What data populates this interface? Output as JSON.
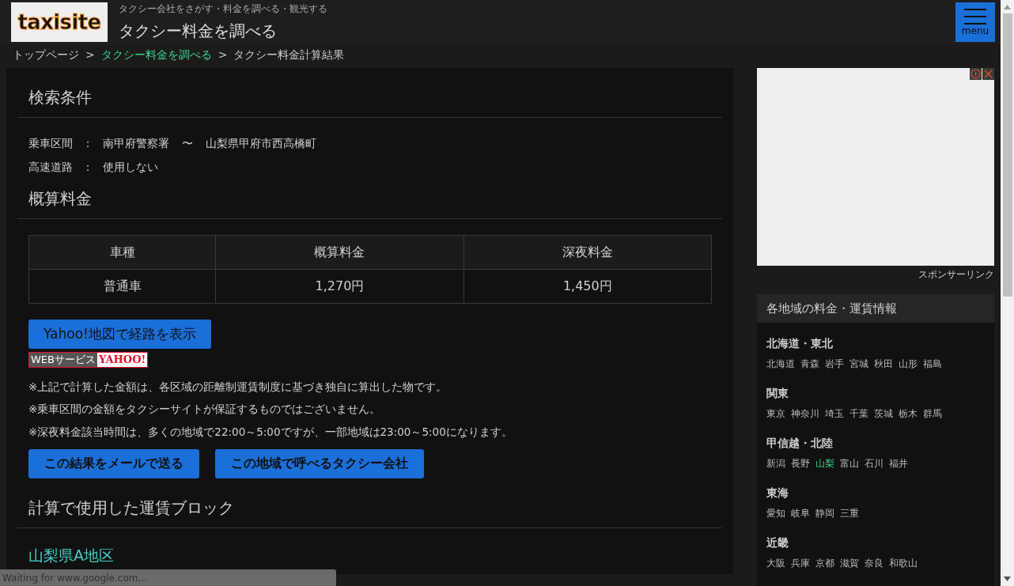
{
  "header": {
    "logo": "taxisite",
    "tagline": "タクシー会社をさがす・料金を調べる・観光する",
    "title": "タクシー料金を調べる",
    "menu_label": "menu"
  },
  "breadcrumb": [
    {
      "label": "トップページ",
      "link": false
    },
    {
      "label": "タクシー料金を調べる",
      "link": true
    },
    {
      "label": "タクシー料金計算結果",
      "link": false
    }
  ],
  "breadcrumb_separator": ">",
  "conditions": {
    "heading": "検索条件",
    "separator": "：",
    "rows": [
      {
        "label": "乗車区間",
        "value_from": "南甲府警察署",
        "connector": "〜",
        "value_to": "山梨県甲府市西高橋町"
      },
      {
        "label": "高速道路",
        "value_from": "使用しない"
      }
    ]
  },
  "fare": {
    "heading": "概算料金",
    "columns": [
      "車種",
      "概算料金",
      "深夜料金"
    ],
    "rows": [
      [
        "普通車",
        "1,270円",
        "1,450円"
      ]
    ]
  },
  "map_button": "Yahoo!地図で経路を表示",
  "yahoo_badge": {
    "left": "WEBサービス",
    "right": "YAHOO!"
  },
  "notes": [
    "※上記で計算した金額は、各区域の距離制運賃制度に基づき独自に算出した物です。",
    "※乗車区間の金額をタクシーサイトが保証するものではございません。",
    "※深夜料金該当時間は、多くの地域で22:00～5:00ですが、一部地域は23:00～5:00になります。"
  ],
  "actions": [
    "この結果をメールで送る",
    "この地域で呼べるタクシー会社"
  ],
  "block": {
    "heading": "計算で使用した運賃ブロック",
    "subheading": "山梨県A地区"
  },
  "ad": {
    "caption": "スポンサーリンク"
  },
  "regions": {
    "heading": "各地域の料金・運賃情報",
    "groups": [
      {
        "name": "北海道・東北",
        "items": [
          {
            "label": "北海道",
            "selected": false
          },
          {
            "label": "青森",
            "selected": false
          },
          {
            "label": "岩手",
            "selected": false
          },
          {
            "label": "宮城",
            "selected": false
          },
          {
            "label": "秋田",
            "selected": false
          },
          {
            "label": "山形",
            "selected": false
          },
          {
            "label": "福島",
            "selected": false
          }
        ]
      },
      {
        "name": "関東",
        "items": [
          {
            "label": "東京",
            "selected": false
          },
          {
            "label": "神奈川",
            "selected": false
          },
          {
            "label": "埼玉",
            "selected": false
          },
          {
            "label": "千葉",
            "selected": false
          },
          {
            "label": "茨城",
            "selected": false
          },
          {
            "label": "栃木",
            "selected": false
          },
          {
            "label": "群馬",
            "selected": false
          }
        ]
      },
      {
        "name": "甲信越・北陸",
        "items": [
          {
            "label": "新潟",
            "selected": false
          },
          {
            "label": "長野",
            "selected": false
          },
          {
            "label": "山梨",
            "selected": true
          },
          {
            "label": "富山",
            "selected": false
          },
          {
            "label": "石川",
            "selected": false
          },
          {
            "label": "福井",
            "selected": false
          }
        ]
      },
      {
        "name": "東海",
        "items": [
          {
            "label": "愛知",
            "selected": false
          },
          {
            "label": "岐阜",
            "selected": false
          },
          {
            "label": "静岡",
            "selected": false
          },
          {
            "label": "三重",
            "selected": false
          }
        ]
      },
      {
        "name": "近畿",
        "items": [
          {
            "label": "大阪",
            "selected": false
          },
          {
            "label": "兵庫",
            "selected": false
          },
          {
            "label": "京都",
            "selected": false
          },
          {
            "label": "滋賀",
            "selected": false
          },
          {
            "label": "奈良",
            "selected": false
          },
          {
            "label": "和歌山",
            "selected": false
          }
        ]
      }
    ]
  },
  "status_bar": "Waiting for www.google.com..."
}
